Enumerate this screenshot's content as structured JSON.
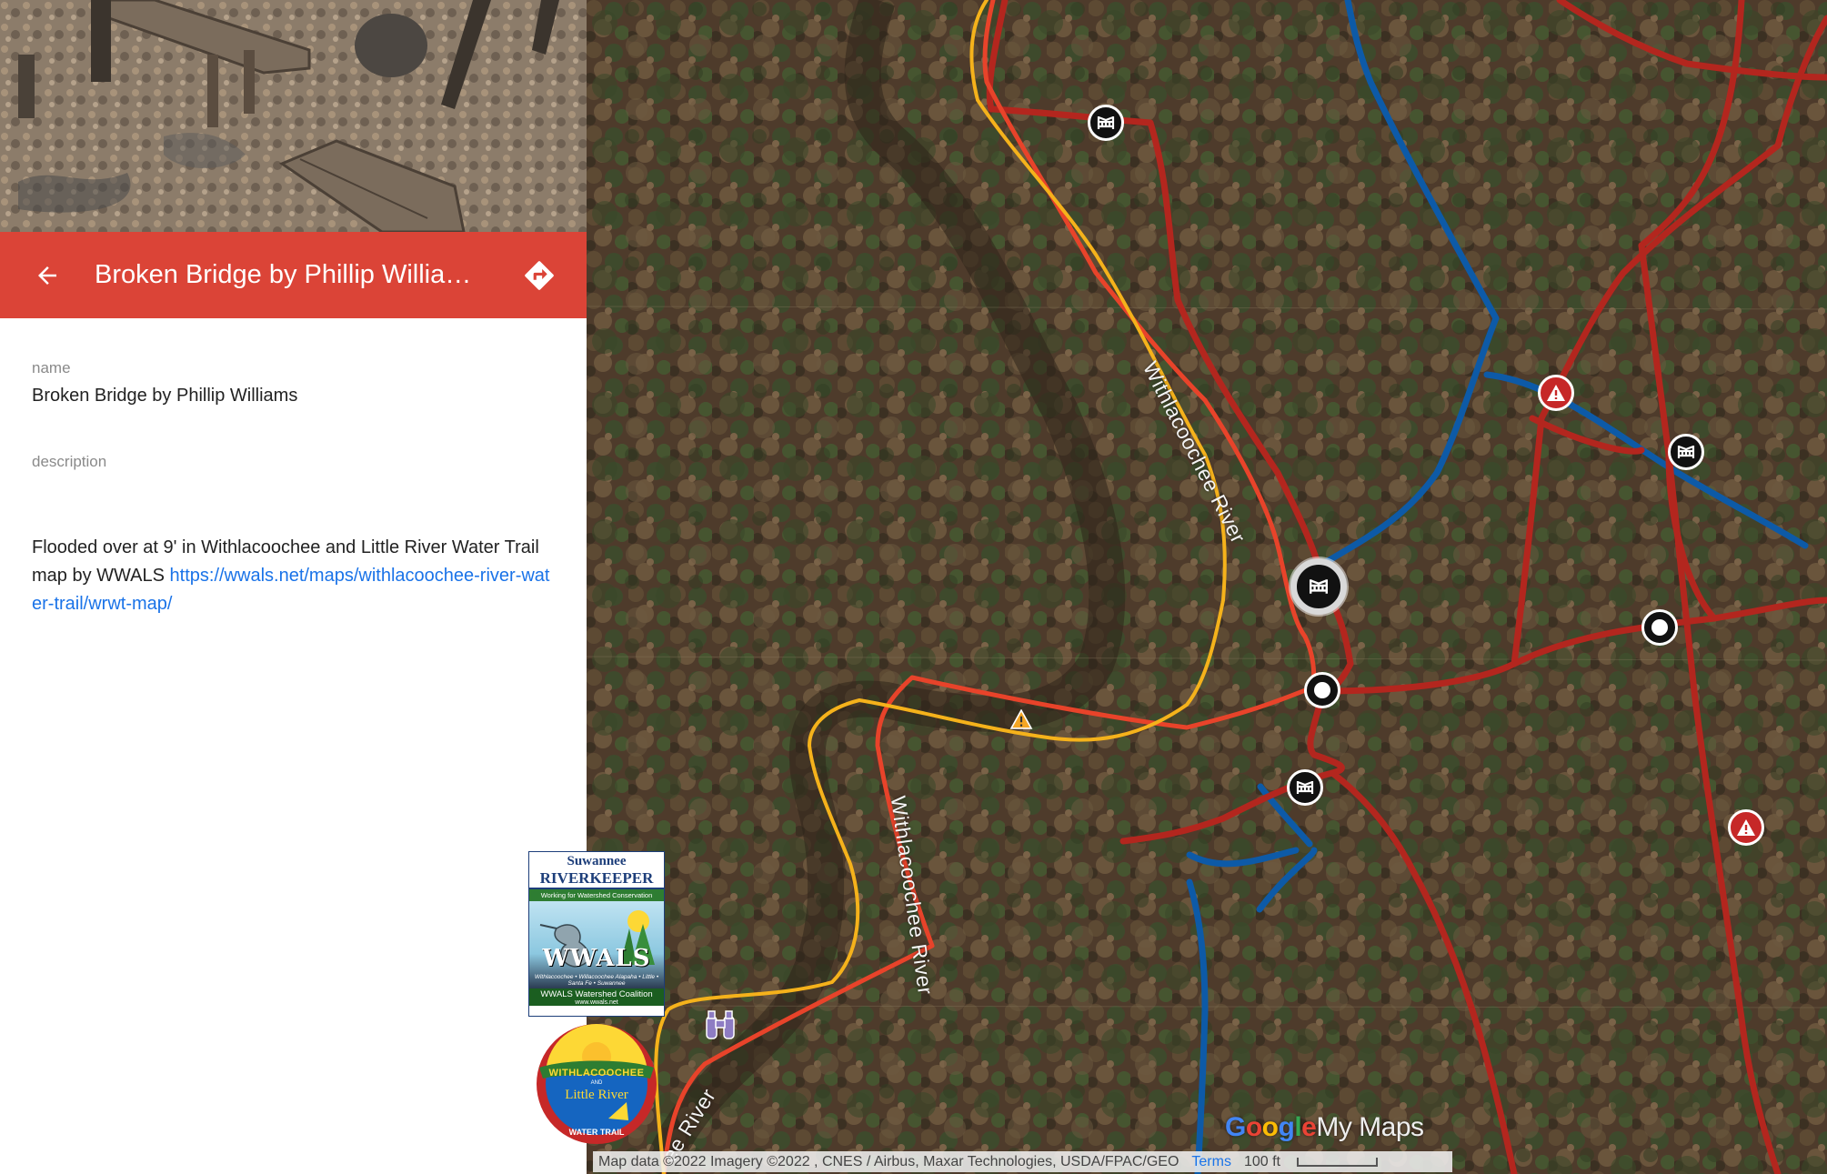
{
  "place": {
    "title": "Broken Bridge by Phillip Willia…",
    "fields": [
      {
        "label": "name",
        "value": "Broken Bridge by Phillip Williams"
      },
      {
        "label": "description",
        "value": ""
      }
    ],
    "description_text": "Flooded over at 9' in Withlacoochee and Little River Water Trail map by WWALS",
    "description_link": "https://wwals.net/maps/withlacoochee-river-water-trail/wrwt-map/"
  },
  "map": {
    "river_labels": [
      "Withlacoochee River",
      "Withlacoochee River",
      "ee River"
    ],
    "attribution": "Map data ©2022 Imagery ©2022 , CNES / Airbus, Maxar Technologies, USDA/FPAC/GEO",
    "terms_label": "Terms",
    "scale_label": "100 ft",
    "logo": {
      "google": "Google",
      "mymaps": "My Maps"
    },
    "colors": {
      "trail_red": "#b71c1c",
      "trail_orange": "#e8412a",
      "water_blue": "#0d5aa7",
      "river_yellow": "#f5b21b",
      "header_red": "#db4437"
    }
  },
  "logos": {
    "wwals": {
      "line1": "Suwannee",
      "line2": "RIVERKEEPER",
      "tagline": "Working for Watershed Conservation",
      "name": "WWALS",
      "rivers": "Withlacoochee • Willacoochee Alapaha • Little • Santa Fe • Suwannee",
      "coalition": "WWALS Watershed Coalition",
      "site": "www.wwals.net"
    },
    "trail": {
      "line1": "WITHLACOOCHEE",
      "and": "AND",
      "line2": "Little River",
      "line3": "WATER TRAIL"
    }
  }
}
